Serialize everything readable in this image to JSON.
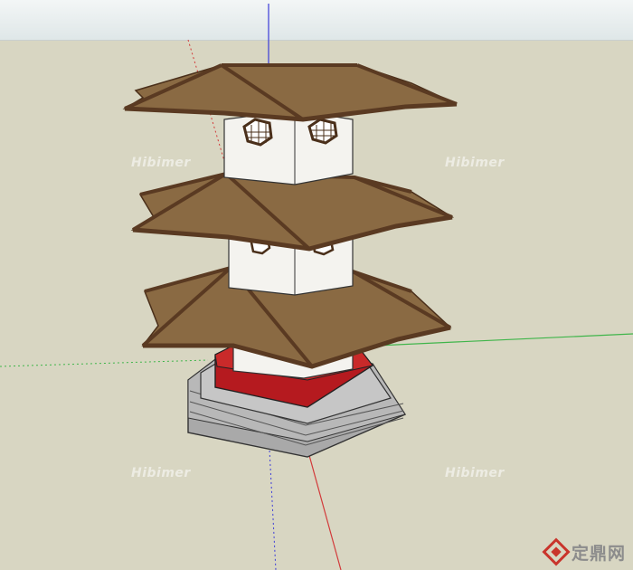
{
  "viewport": {
    "watermark_text": "Hibimer",
    "site_logo_text": "定鼎网"
  },
  "colors": {
    "background": "#d8d6c2",
    "sky": "#e9eeee",
    "roof": "#8a6a43",
    "roof_edge": "#5a3a22",
    "wall": "#f4f3ef",
    "base_red": "#b51a1f",
    "stone": "#a9a9a9",
    "axis_blue": "#3a3ad8",
    "axis_green": "#3fb54a",
    "axis_red": "#d23a3a"
  },
  "icons": {
    "model": "pagoda-model-icon",
    "logo": "diamond-logo-icon"
  }
}
